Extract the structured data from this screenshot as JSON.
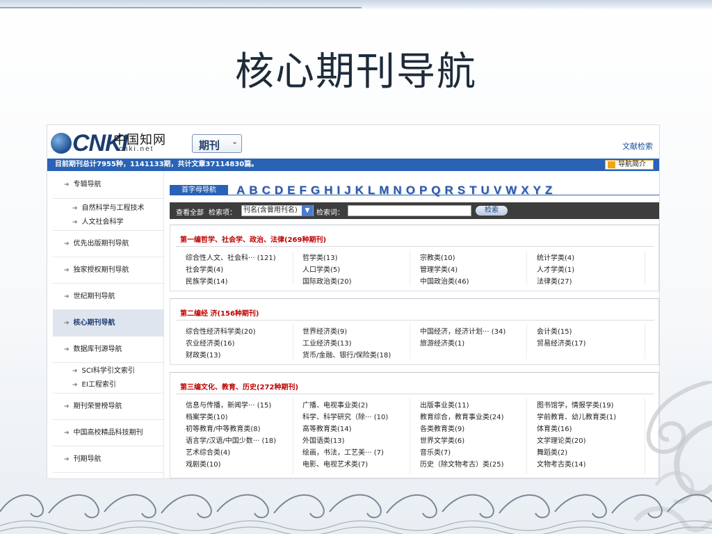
{
  "slide": {
    "title": "核心期刊导航"
  },
  "header": {
    "logo_text": "CNKI",
    "logo_cn": "中国知网",
    "logo_url": "cnki.net",
    "product_select": "期刊",
    "doc_search_link": "文献检索"
  },
  "summary_bar": {
    "text": "目前期刊总计7955种，1141133期，共计文章37114830篇。",
    "guide_button": "导航简介"
  },
  "sidebar": {
    "items": [
      {
        "label": "专辑导航"
      },
      {
        "label": "自然科学与工程技术"
      },
      {
        "label": "人文社会科学"
      },
      {
        "label": "优先出版期刊导航"
      },
      {
        "label": "独家授权期刊导航"
      },
      {
        "label": "世纪期刊导航"
      },
      {
        "label": "核心期刊导航"
      },
      {
        "label": "数据库刊源导航"
      },
      {
        "label": "SCI科学引文索引"
      },
      {
        "label": "EI工程索引"
      },
      {
        "label": "期刊荣誉榜导航"
      },
      {
        "label": "中国高校精品科技期刊"
      },
      {
        "label": "刊期导航"
      }
    ]
  },
  "letter_nav": {
    "tab_label": "首字母导航",
    "letters": [
      "A",
      "B",
      "C",
      "D",
      "E",
      "F",
      "G",
      "H",
      "I",
      "J",
      "K",
      "L",
      "M",
      "N",
      "O",
      "P",
      "Q",
      "R",
      "S",
      "T",
      "U",
      "V",
      "W",
      "X",
      "Y",
      "Z"
    ]
  },
  "search": {
    "view_all": "查看全部",
    "field_label": "检索项：",
    "field_value": "刊名(含曾用刊名)",
    "keyword_label": "检索词：",
    "keyword_value": "",
    "button": "检索"
  },
  "sections": [
    {
      "title": "第一编哲学、社会学、政治、法律(269种期刊)",
      "rows": [
        [
          "综合性人文、社会科···  (121)",
          "哲学类(13)",
          "宗教类(10)",
          "统计学类(4)"
        ],
        [
          "社会学类(4)",
          "人口学类(5)",
          "管理学类(4)",
          "人才学类(1)"
        ],
        [
          "民族学类(14)",
          "国际政治类(20)",
          "中国政治类(46)",
          "法律类(27)"
        ]
      ]
    },
    {
      "title": "第二编经 济(156种期刊)",
      "rows": [
        [
          "综合性经济科学类(20)",
          "世界经济类(9)",
          "中国经济，经济计划···  (34)",
          "会计类(15)"
        ],
        [
          "农业经济类(16)",
          "工业经济类(13)",
          "旅游经济类(1)",
          "贸易经济类(17)"
        ],
        [
          "财政类(13)",
          "货币/金融、银行/保险类(18)",
          "",
          ""
        ]
      ]
    },
    {
      "title": "第三编文化、教育、历史(272种期刊)",
      "rows": [
        [
          "信息与传播，新闻学···  (15)",
          "广播、电视事业类(2)",
          "出版事业类(11)",
          "图书馆学，情报学类(19)"
        ],
        [
          "档案学类(10)",
          "科学、科学研究（除···  (10)",
          "教育综合，教育事业类(24)",
          "学前教育、幼儿教育类(1)"
        ],
        [
          "初等教育/中等教育类(8)",
          "高等教育类(14)",
          "各类教育类(9)",
          "体育类(16)"
        ],
        [
          "语言学/汉语/中国少数···  (18)",
          "外国语类(13)",
          "世界文学类(6)",
          "文学理论类(20)"
        ],
        [
          "艺术综合类(4)",
          "绘画，书法，工艺美···  (7)",
          "音乐类(7)",
          "舞蹈类(2)"
        ],
        [
          "戏剧类(10)",
          "电影、电视艺术类(7)",
          "历史（除文物考古）类(25)",
          "文物考古类(14)"
        ]
      ]
    }
  ]
}
